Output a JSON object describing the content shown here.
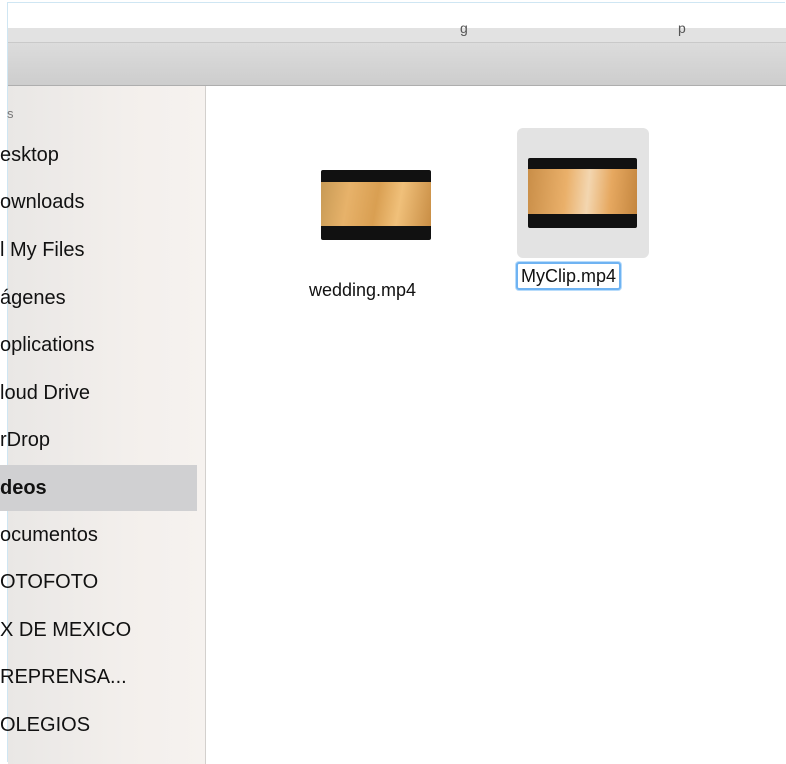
{
  "window": {
    "title_fragments": [
      "g",
      "p"
    ]
  },
  "sidebar": {
    "heading": "s",
    "items": [
      {
        "label": "esktop"
      },
      {
        "label": "ownloads"
      },
      {
        "label": "l My Files"
      },
      {
        "label": "ágenes"
      },
      {
        "label": "oplications"
      },
      {
        "label": "loud Drive"
      },
      {
        "label": "rDrop"
      },
      {
        "label": "deos",
        "selected": true
      },
      {
        "label": "ocumentos"
      },
      {
        "label": "OTOFOTO"
      },
      {
        "label": "X DE MEXICO"
      },
      {
        "label": "REPRENSA..."
      },
      {
        "label": "OLEGIOS"
      }
    ]
  },
  "files": [
    {
      "name": "wedding.mp4",
      "type": "video",
      "selected": false
    },
    {
      "name": "MyClip.mp4",
      "type": "video",
      "selected": true,
      "renaming": true
    }
  ],
  "colors": {
    "selection_focus": "#6fb3f2",
    "sidebar_selected": "#d0d0d2"
  }
}
